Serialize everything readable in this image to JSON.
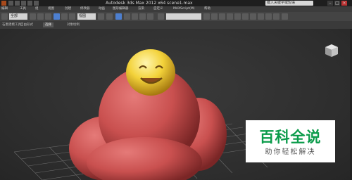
{
  "title_bar": {
    "title": "Autodesk 3ds Max  2012 x64      scene1.max",
    "search_placeholder": "键入关键字或短语",
    "window_controls": [
      "–",
      "□",
      "×"
    ]
  },
  "menu_bar": {
    "items": [
      "编辑",
      "工具",
      "组",
      "视图",
      "创建",
      "修改器",
      "动画",
      "图形编辑器",
      "渲染",
      "自定义",
      "MAXScript(M)",
      "帮助"
    ]
  },
  "toolbar": {
    "selection_filter": "全部",
    "reference_coordinate": "视图",
    "named_selection": ""
  },
  "ribbon": {
    "tabs": [
      "石墨建模工具",
      "自由形式",
      "选择",
      "对象绘制"
    ],
    "active_tab": "选择"
  },
  "viewport": {
    "label": ""
  },
  "watermark": {
    "main": "百科全说",
    "sub": "助你轻松解决"
  },
  "colors": {
    "title_bg": "#1e1e1e",
    "viewport_bg": "#2d2d2d",
    "body_red": "#c9504f",
    "smiley_yellow": "#f3d23a",
    "watermark_green": "#0a9b4a",
    "active_tool": "#4d7fcf"
  }
}
